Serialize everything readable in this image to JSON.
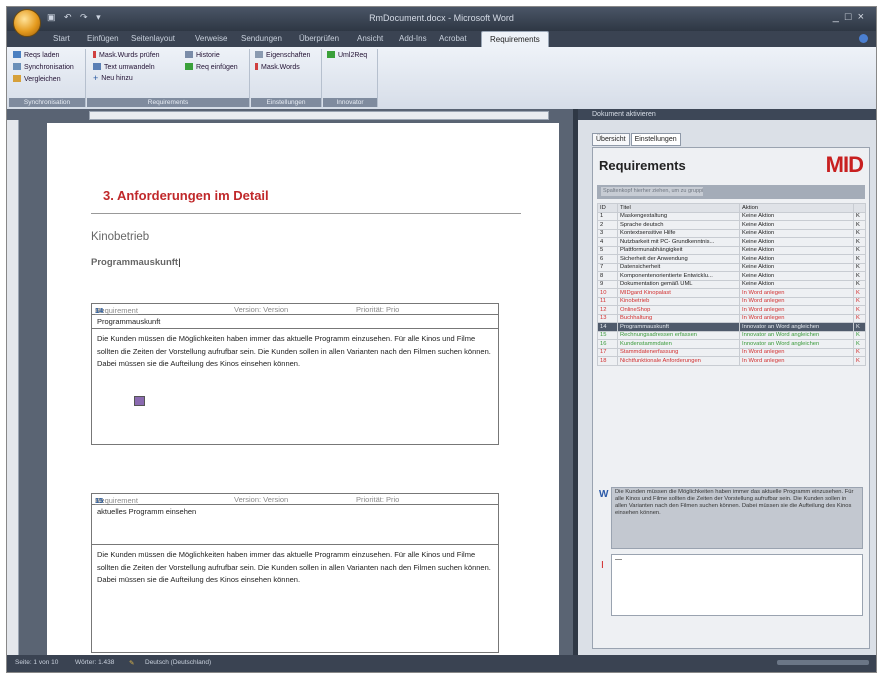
{
  "window": {
    "title": "RmDocument.docx - Microsoft Word",
    "qat_icons": [
      "save-icon",
      "undo-icon",
      "redo-icon"
    ],
    "controls": [
      "_",
      "□",
      "×"
    ]
  },
  "tabs": [
    "Start",
    "Einfügen",
    "Seitenlayout",
    "Verweise",
    "Sendungen",
    "Überprüfen",
    "Ansicht",
    "Add-Ins",
    "Acrobat",
    "Requirements"
  ],
  "active_tab": "Requirements",
  "ribbon": {
    "groups": [
      {
        "label": "Synchronisation",
        "items": [
          "Reqs laden",
          "Synchronisation",
          "Vergleichen"
        ]
      },
      {
        "label": "Requirements",
        "items": [
          "Mask.Wurds prüfen",
          "Historie",
          "Text umwandeln",
          "Req einfügen",
          "Neu hinzu"
        ]
      },
      {
        "label": "Einstellungen",
        "items": [
          "Eigenschaften",
          "Mask.Words"
        ]
      },
      {
        "label": "Innovator",
        "items": [
          "Uml2Req"
        ]
      }
    ]
  },
  "document": {
    "chapter": "3. Anforderungen im Detail",
    "h2": "Kinobetrieb",
    "h3": "Programmauskunft",
    "requirements": [
      {
        "label": "Requirement",
        "id_label": "ID:",
        "id": "14",
        "version": "Version: Version",
        "priority": "Priorität: Prio",
        "name": "Programmauskunft",
        "description": "Die Kunden müssen die Möglichkeiten haben immer das aktuelle Programm einzusehen. Für alle Kinos und Filme sollten die Zeiten der Vorstellung aufrufbar sein. Die Kunden sollen in allen Varianten nach den Filmen suchen können. Dabei müssen sie die Aufteilung des Kinos einsehen können."
      },
      {
        "label": "Requirement",
        "id_label": "ID:",
        "id": "15",
        "version": "Version: Version",
        "priority": "Priorität: Prio",
        "name": "aktuelles Programm einsehen",
        "description": "Die Kunden müssen die Möglichkeiten haben immer das aktuelle Programm einzusehen. Für alle Kinos und Filme sollten die Zeiten der Vorstellung aufrufbar sein. Die Kunden sollen in allen Varianten nach den Filmen suchen können. Dabei müssen sie die Aufteilung des Kinos einsehen können."
      }
    ]
  },
  "panel": {
    "title": "Dokument aktivieren",
    "tabs": [
      "Übersicht",
      "Einstellungen"
    ],
    "heading": "Requirements",
    "logo": "MID",
    "group_placeholder": "Spaltenkopf hierher ziehen, um zu gruppieren",
    "columns": [
      "ID",
      "Titel",
      "Aktion",
      ""
    ],
    "rows": [
      {
        "id": "1",
        "title": "Maskengestaltung",
        "action": "Keine Aktion",
        "k": "K",
        "style": "normal"
      },
      {
        "id": "2",
        "title": "Sprache deutsch",
        "action": "Keine Aktion",
        "k": "K",
        "style": "normal"
      },
      {
        "id": "3",
        "title": "Kontextsensitive Hilfe",
        "action": "Keine Aktion",
        "k": "K",
        "style": "normal"
      },
      {
        "id": "4",
        "title": "Nutzbarkeit mit PC- Grundkenntnis...",
        "action": "Keine Aktion",
        "k": "K",
        "style": "normal"
      },
      {
        "id": "5",
        "title": "Plattformunabhängigkeit",
        "action": "Keine Aktion",
        "k": "K",
        "style": "normal"
      },
      {
        "id": "6",
        "title": "Sicherheit der Anwendung",
        "action": "Keine Aktion",
        "k": "K",
        "style": "normal"
      },
      {
        "id": "7",
        "title": "Datensicherheit",
        "action": "Keine Aktion",
        "k": "K",
        "style": "normal"
      },
      {
        "id": "8",
        "title": "Komponentenorientierte Entwicklu...",
        "action": "Keine Aktion",
        "k": "K",
        "style": "normal"
      },
      {
        "id": "9",
        "title": "Dokumentation gemäß UML",
        "action": "Keine Aktion",
        "k": "K",
        "style": "normal"
      },
      {
        "id": "10",
        "title": "MIDgard Kinopalast",
        "action": "In Word anlegen",
        "k": "K",
        "style": "red"
      },
      {
        "id": "11",
        "title": "Kinobetrieb",
        "action": "In Word anlegen",
        "k": "K",
        "style": "red"
      },
      {
        "id": "12",
        "title": "OnlineShop",
        "action": "In Word anlegen",
        "k": "K",
        "style": "red"
      },
      {
        "id": "13",
        "title": "Buchhaltung",
        "action": "In Word anlegen",
        "k": "K",
        "style": "red"
      },
      {
        "id": "14",
        "title": "Programmauskunft",
        "action": "Innovator an Word angleichen",
        "k": "K",
        "style": "sel"
      },
      {
        "id": "15",
        "title": "Rechnungsadressen erfassen",
        "action": "Innovator an Word angleichen",
        "k": "K",
        "style": "green"
      },
      {
        "id": "16",
        "title": "Kundenstammdaten",
        "action": "Innovator an Word angleichen",
        "k": "K",
        "style": "green"
      },
      {
        "id": "17",
        "title": "Stammdatenerfassung",
        "action": "In Word anlegen",
        "k": "K",
        "style": "red"
      },
      {
        "id": "18",
        "title": "Nichtfunktionale Anforderungen",
        "action": "In Word anlegen",
        "k": "K",
        "style": "red"
      }
    ],
    "word_tag": "W",
    "word_text": "Die Kunden müssen die Möglichkeiten haben immer das aktuelle Programm einzusehen. Für alle Kinos und Filme sollten die Zeiten der Vorstellung aufrufbar sein. Die Kunden sollen in allen Varianten nach den Filmen suchen können. Dabei müssen sie die Aufteilung des Kinos einsehen können.",
    "innovator_tag": "I",
    "innovator_text": "—"
  },
  "status": {
    "page": "Seite: 1 von 10",
    "words": "Wörter: 1.438",
    "language": "Deutsch (Deutschland)"
  }
}
